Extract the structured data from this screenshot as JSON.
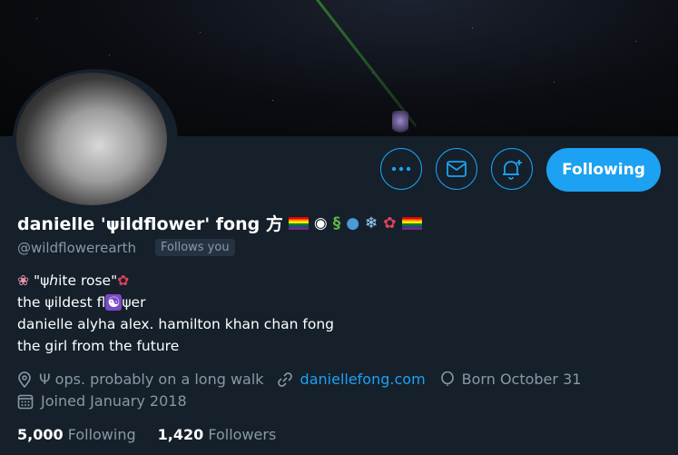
{
  "profile": {
    "display_name": "danielle 'ψildflower' fong 方",
    "handle": "@wildflowerearth",
    "follows_you": "Follows you",
    "bio": [
      "\"ψℎite rose\"",
      "the ψildest fl",
      "danielle alyha alex. hamilton khan chan fong",
      "the girl from the future"
    ],
    "bio_line2_suffix": "ψer",
    "location": "Ψ ops. probably on a long walk",
    "website": "daniellefong.com",
    "birthday": "Born October 31",
    "joined": "Joined January 2018",
    "following_count": "5,000",
    "following_label": "Following",
    "followers_count": "1,420",
    "followers_label": "Followers"
  },
  "actions": {
    "more_icon": "more-dots-icon",
    "message_icon": "envelope-icon",
    "notify_icon": "bell-plus-icon",
    "follow_button": "Following"
  },
  "colors": {
    "background": "#15202b",
    "accent": "#1da1f2",
    "secondary_text": "#8899a6"
  }
}
